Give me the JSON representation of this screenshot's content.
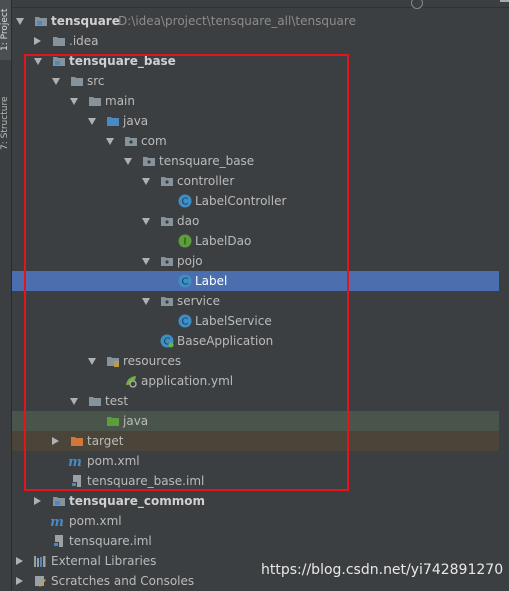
{
  "side_tabs": [
    {
      "label": "1: Project",
      "active": true
    },
    {
      "label": "7: Structure",
      "active": false
    }
  ],
  "toolbar": {
    "title_partial": "Project"
  },
  "tree": [
    {
      "label": "tensquare",
      "path": "D:\\idea\\project\\tensquare_all\\tensquare",
      "icon": "module-folder-icon",
      "expanded": true,
      "bold": true
    },
    {
      "label": ".idea",
      "icon": "folder-icon",
      "expanded": false
    },
    {
      "label": "tensquare_base",
      "icon": "module-folder-icon",
      "expanded": true,
      "bold": true
    },
    {
      "label": "src",
      "icon": "folder-icon",
      "expanded": true
    },
    {
      "label": "main",
      "icon": "folder-icon",
      "expanded": true
    },
    {
      "label": "java",
      "icon": "source-root-folder-icon",
      "expanded": true
    },
    {
      "label": "com",
      "icon": "package-icon",
      "expanded": true
    },
    {
      "label": "tensquare_base",
      "icon": "package-icon",
      "expanded": true
    },
    {
      "label": "controller",
      "icon": "package-icon",
      "expanded": true
    },
    {
      "label": "LabelController",
      "icon": "class-icon"
    },
    {
      "label": "dao",
      "icon": "package-icon",
      "expanded": true
    },
    {
      "label": "LabelDao",
      "icon": "interface-icon"
    },
    {
      "label": "pojo",
      "icon": "package-icon",
      "expanded": true
    },
    {
      "label": "Label",
      "icon": "class-icon",
      "selected": true
    },
    {
      "label": "service",
      "icon": "package-icon",
      "expanded": true
    },
    {
      "label": "LabelService",
      "icon": "class-icon"
    },
    {
      "label": "BaseApplication",
      "icon": "spring-boot-class-icon"
    },
    {
      "label": "resources",
      "icon": "resources-folder-icon",
      "expanded": true
    },
    {
      "label": "application.yml",
      "icon": "spring-yml-icon"
    },
    {
      "label": "test",
      "icon": "folder-icon",
      "expanded": true
    },
    {
      "label": "java",
      "icon": "test-root-folder-icon"
    },
    {
      "label": "target",
      "icon": "excluded-folder-icon",
      "expanded": false
    },
    {
      "label": "pom.xml",
      "icon": "maven-icon"
    },
    {
      "label": "tensquare_base.iml",
      "icon": "iml-file-icon"
    },
    {
      "label": "tensquare_commom",
      "icon": "module-folder-icon",
      "expanded": false,
      "bold": true
    },
    {
      "label": "pom.xml",
      "icon": "maven-icon"
    },
    {
      "label": "tensquare.iml",
      "icon": "iml-file-icon"
    },
    {
      "label": "External Libraries",
      "icon": "libraries-icon",
      "expanded": false
    },
    {
      "label": "Scratches and Consoles",
      "icon": "scratches-icon",
      "expanded": false
    }
  ],
  "watermark": "https://blog.csdn.net/yi742891270",
  "colors": {
    "selection": "#4b6eaf",
    "highlight_box": "#e3141b",
    "class_icon": "#3d8fc6",
    "interface_icon": "#5c9e3c"
  }
}
